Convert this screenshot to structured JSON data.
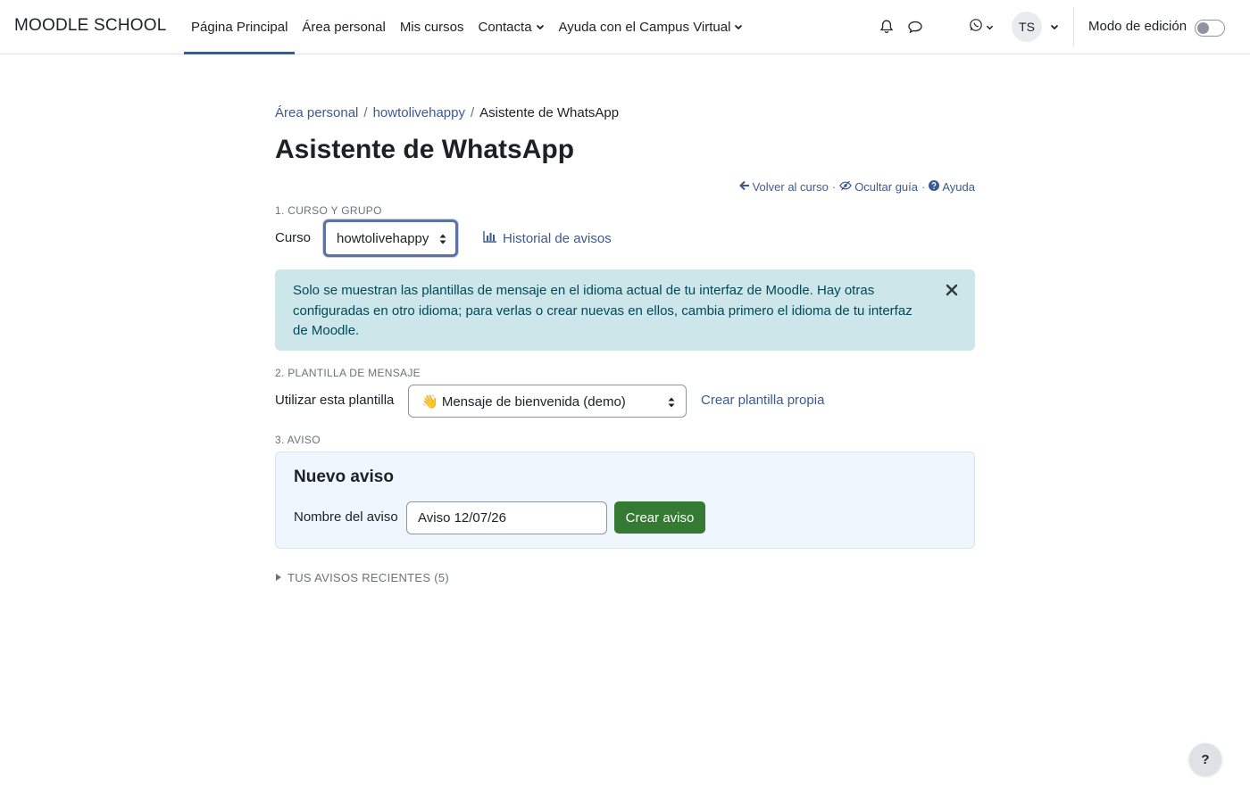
{
  "navbar": {
    "brand": "MOODLE SCHOOL",
    "links": [
      {
        "label": "Página Principal",
        "active": true,
        "dropdown": false
      },
      {
        "label": "Área personal",
        "active": false,
        "dropdown": false
      },
      {
        "label": "Mis cursos",
        "active": false,
        "dropdown": false
      },
      {
        "label": "Contacta",
        "active": false,
        "dropdown": true
      },
      {
        "label": "Ayuda con el Campus Virtual",
        "active": false,
        "dropdown": true
      }
    ],
    "icons": [
      "bell-icon",
      "chat-bubble-icon",
      "whatsapp-icon"
    ],
    "user_initials": "TS",
    "edit_mode_label": "Modo de edición",
    "edit_mode_on": false
  },
  "breadcrumb": {
    "items": [
      "Área personal",
      "howtolivehappy"
    ],
    "current": "Asistente de WhatsApp"
  },
  "page_title": "Asistente de WhatsApp",
  "top_links": {
    "back": "Volver al curso",
    "hide_guide": "Ocultar guía",
    "help": "Ayuda"
  },
  "section1": {
    "label": "1. CURSO Y GRUPO",
    "course_label": "Curso",
    "course_value": "howtolivehappy",
    "history_link": "Historial de avisos"
  },
  "alert": {
    "text": "Solo se muestran las plantillas de mensaje en el idioma actual de tu interfaz de Moodle. Hay otras configuradas en otro idioma; para verlas o crear nuevas en ellos, cambia primero el idioma de tu interfaz de Moodle."
  },
  "section2": {
    "label": "2. PLANTILLA DE MENSAJE",
    "template_label": "Utilizar esta plantilla",
    "template_value": "👋 Mensaje de bienvenida (demo)",
    "create_link": "Crear plantilla propia"
  },
  "section3": {
    "label": "3. AVISO",
    "card_title": "Nuevo aviso",
    "name_label": "Nombre del aviso",
    "name_value": "Aviso 12/07/26",
    "create_button": "Crear aviso"
  },
  "recent": {
    "label": "TUS AVISOS RECIENTES (5)"
  },
  "help_fab": "?",
  "colors": {
    "link": "#3c5a90",
    "primary_button": "#357a32",
    "alert_bg": "#cce6ea",
    "card_bg": "#eff6fd"
  }
}
